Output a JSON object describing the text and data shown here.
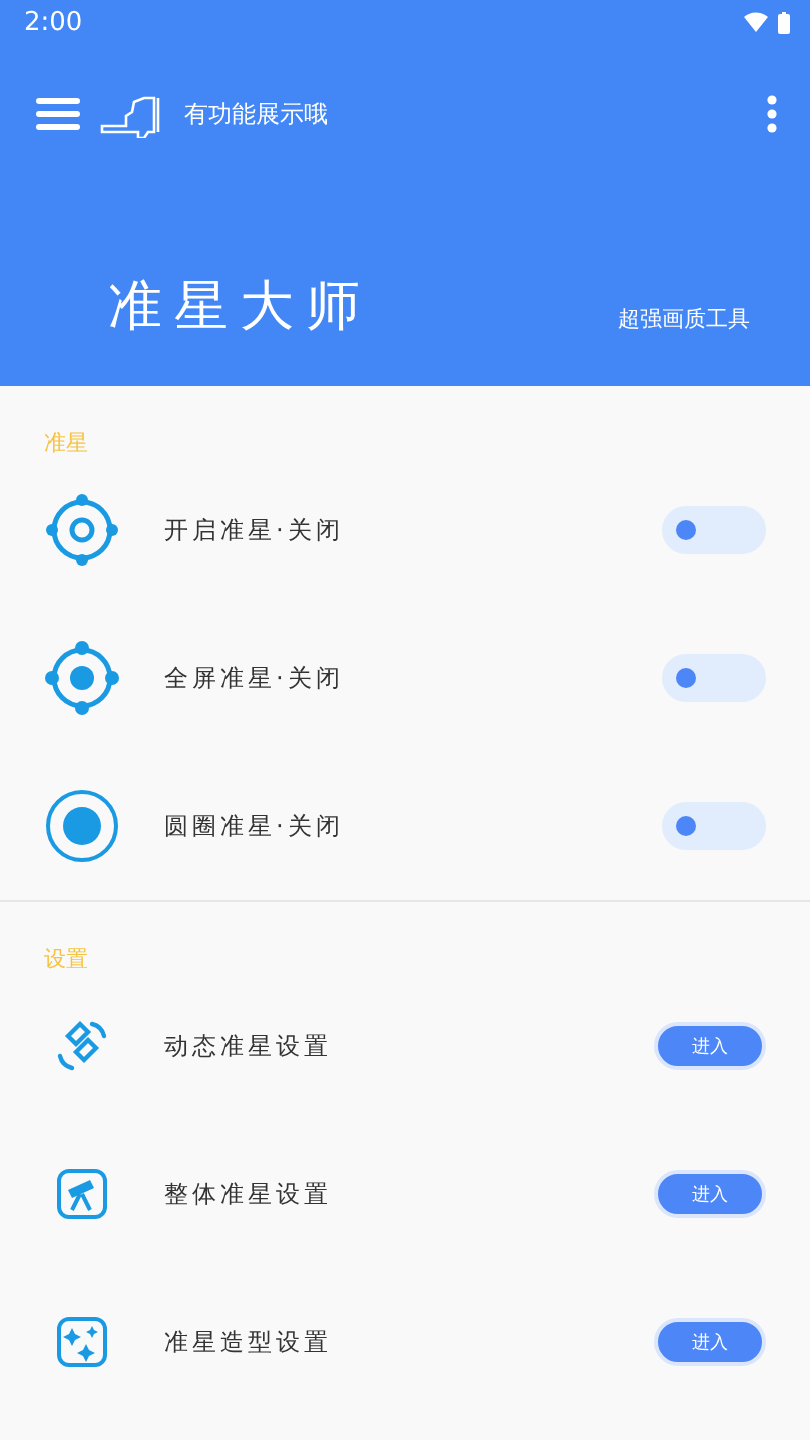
{
  "status_bar": {
    "time": "2:00"
  },
  "toolbar": {
    "subtitle": "有功能展示哦"
  },
  "header": {
    "title": "准星大师",
    "tagline": "超强画质工具"
  },
  "sections": [
    {
      "title": "准星",
      "items": [
        {
          "kind": "toggle",
          "label": "开启准星·关闭",
          "on": false
        },
        {
          "kind": "toggle",
          "label": "全屏准星·关闭",
          "on": false
        },
        {
          "kind": "toggle",
          "label": "圆圈准星·关闭",
          "on": false
        }
      ]
    },
    {
      "title": "设置",
      "items": [
        {
          "kind": "button",
          "label": "动态准星设置",
          "button": "进入"
        },
        {
          "kind": "button",
          "label": "整体准星设置",
          "button": "进入"
        },
        {
          "kind": "button",
          "label": "准星造型设置",
          "button": "进入"
        }
      ]
    }
  ]
}
